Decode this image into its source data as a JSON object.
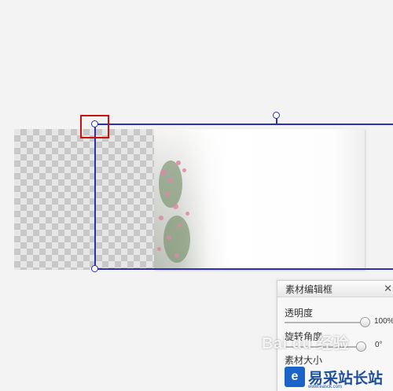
{
  "panel": {
    "title": "素材编辑框",
    "close_glyph": "✕",
    "opacity_label": "透明度",
    "opacity_value": "100%",
    "opacity_level": 1.0,
    "rotation_label": "旋转角度",
    "rotation_value": "0°",
    "size_label": "素材大小"
  },
  "watermarks": {
    "baidu_text": "Bai du 经验",
    "site_logo_glyph": "e",
    "site_name": "易采站长站",
    "site_url": "www.easck.com"
  },
  "colors": {
    "selection": "#2b2fb0",
    "highlight": "#cc1010"
  }
}
